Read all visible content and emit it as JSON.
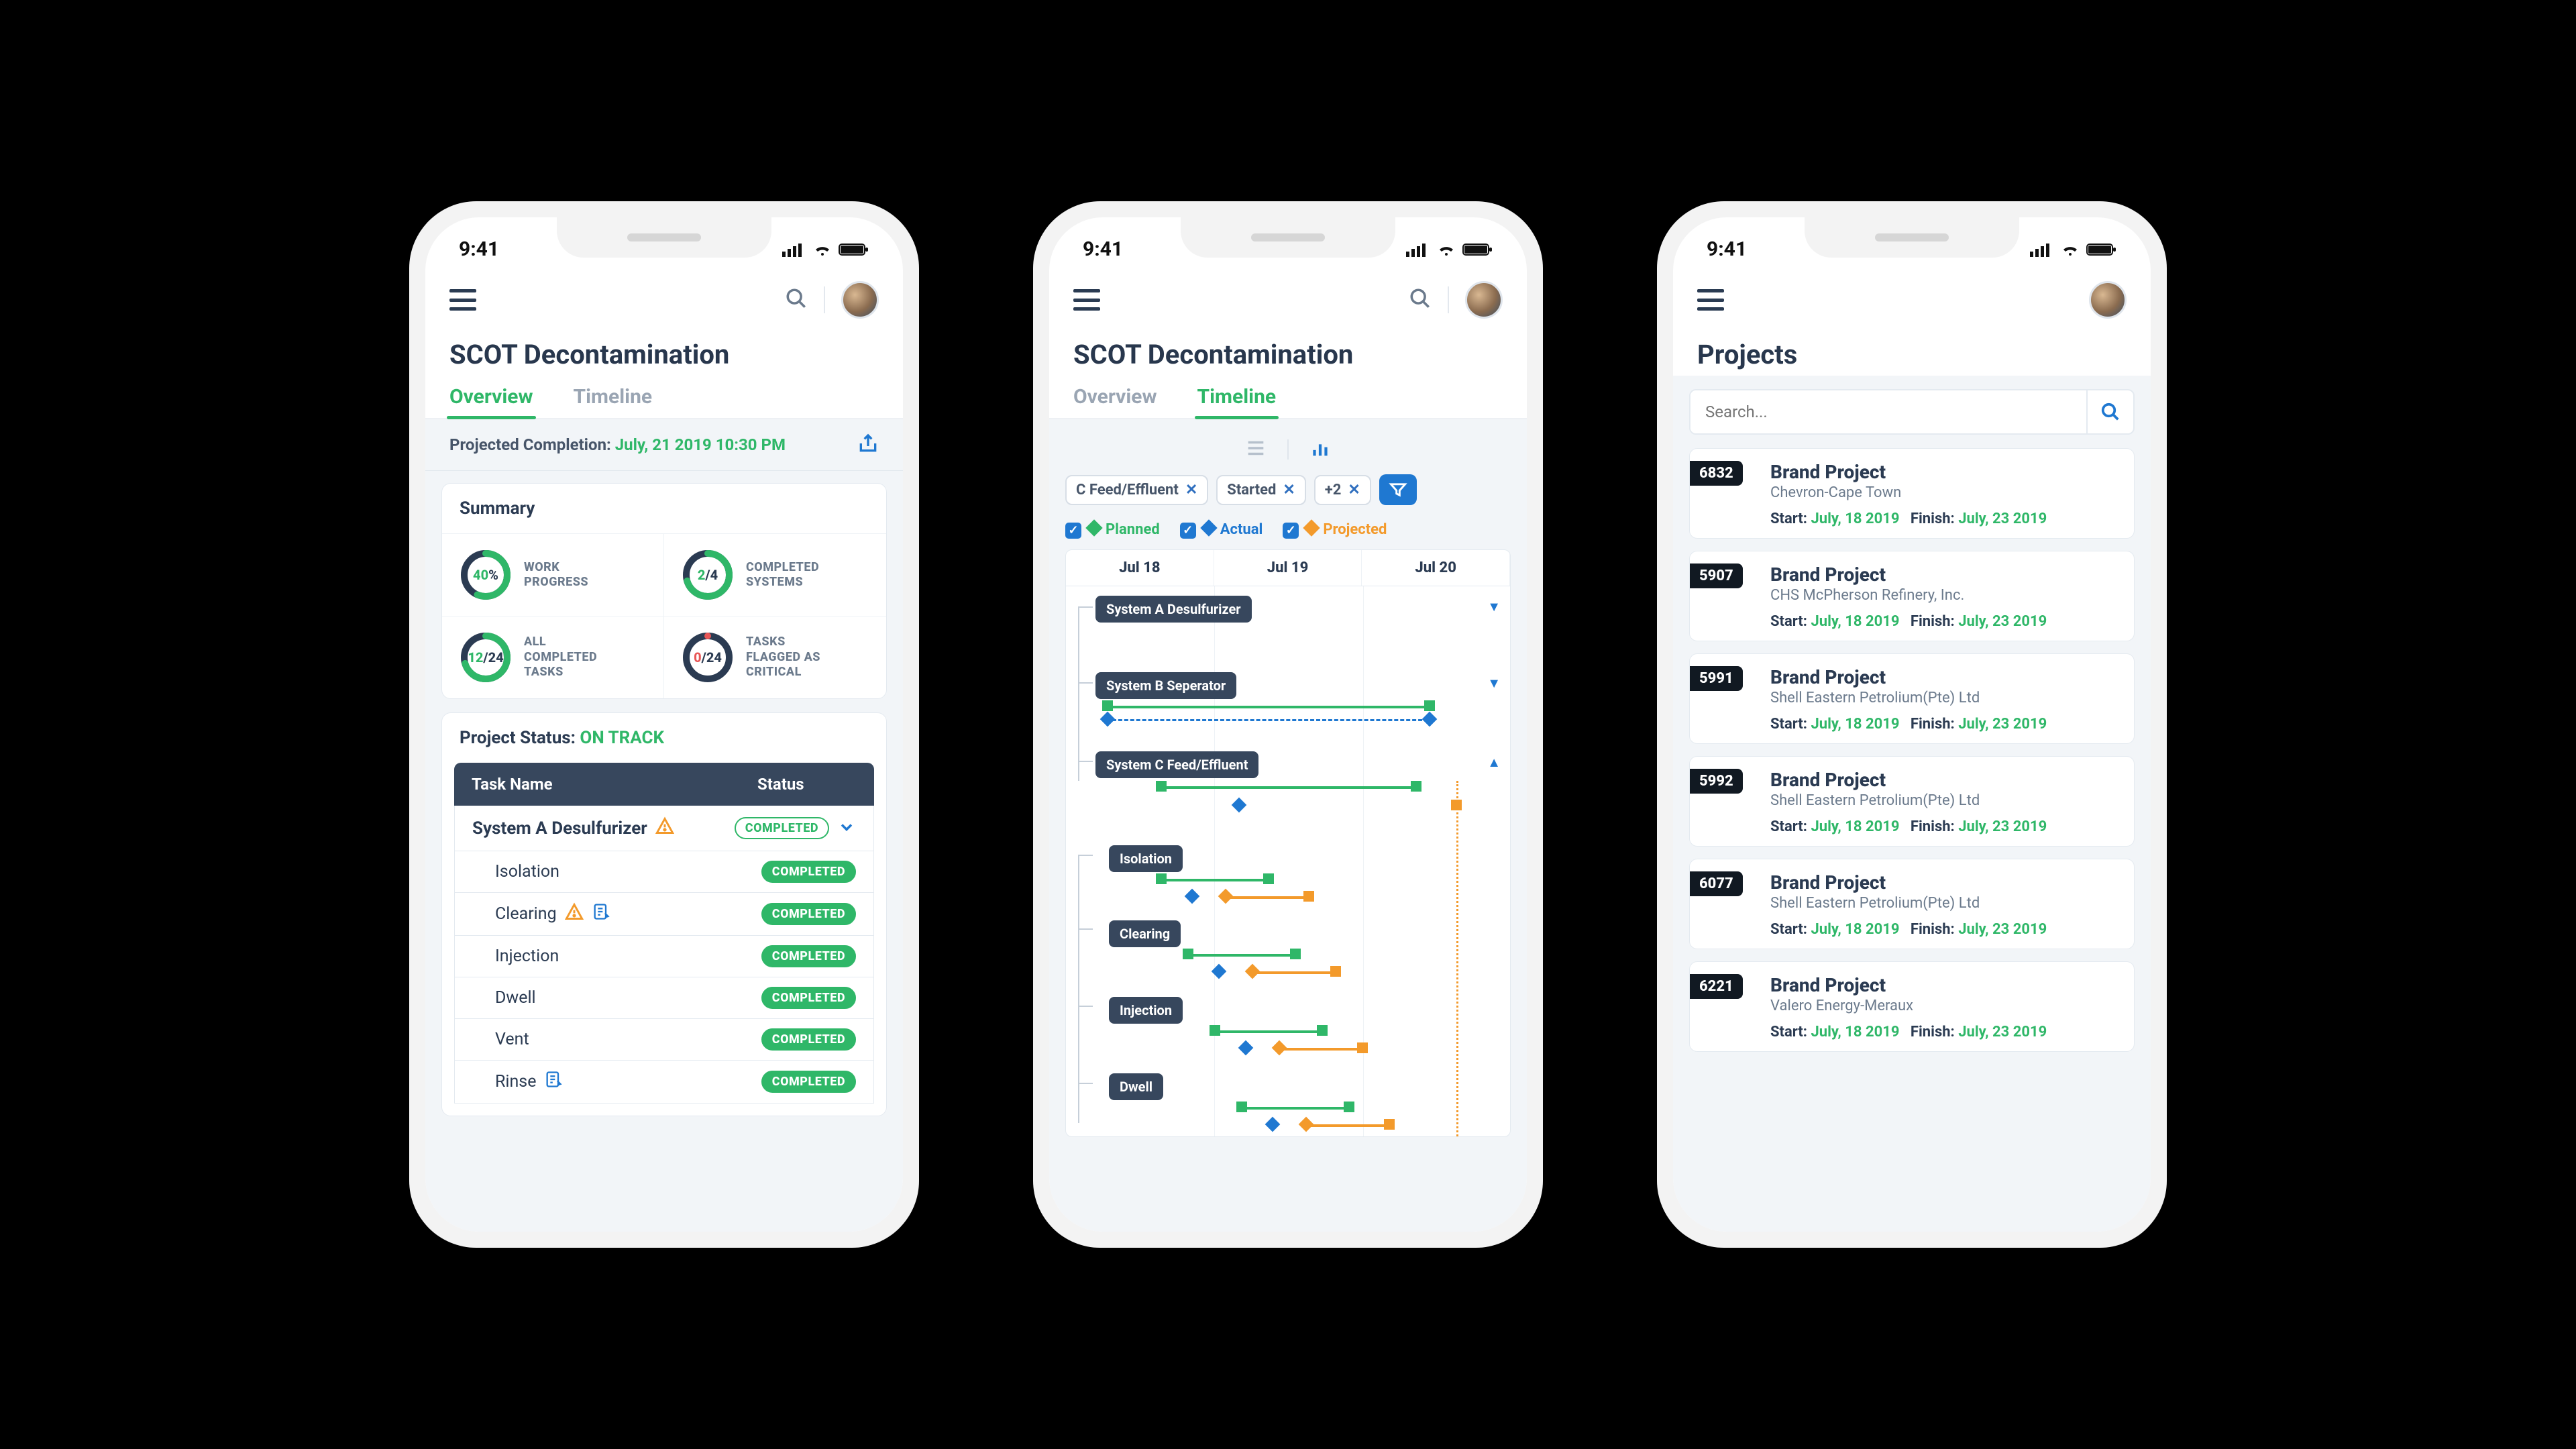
{
  "status_time": "9:41",
  "colors": {
    "accent": "#2fb768",
    "primary_dark": "#37475d",
    "blue": "#1f78d1",
    "orange": "#f39a2b"
  },
  "phone1": {
    "title": "SCOT Decontamination",
    "tabs": {
      "overview": "Overview",
      "timeline": "Timeline",
      "active": "overview"
    },
    "projected_label": "Projected Completion: ",
    "projected_value": "July, 21 2019  10:30 PM",
    "summary_title": "Summary",
    "metrics": [
      {
        "value_html": "<span class='g'>40</span> %",
        "label": "WORK<br>PROGRESS",
        "pct": 40,
        "ring": "green"
      },
      {
        "value_html": "<span class='g'>2</span>/4",
        "label": "COMPLETED<br>SYSTEMS",
        "pct": 50,
        "ring": "green"
      },
      {
        "value_html": "<span class='g'>12</span>/24",
        "label": "ALL<br>COMPLETED<br>TASKS",
        "pct": 50,
        "ring": "green"
      },
      {
        "value_html": "<span class='r'>0</span>/24",
        "label": "TASKS<br>FLAGGED AS<br>CRITICAL",
        "pct": 0,
        "ring": "red"
      }
    ],
    "status_label": "Project Status: ",
    "status_value": "ON TRACK",
    "table": {
      "col_name": "Task Name",
      "col_status": "Status",
      "system": {
        "name": "System A Desulfurizer",
        "badge": "COMPLETED",
        "warn": true
      },
      "tasks": [
        {
          "name": "Isolation",
          "badge": "COMPLETED"
        },
        {
          "name": "Clearing",
          "badge": "COMPLETED",
          "warn": true,
          "note": true
        },
        {
          "name": "Injection",
          "badge": "COMPLETED"
        },
        {
          "name": "Dwell",
          "badge": "COMPLETED"
        },
        {
          "name": "Vent",
          "badge": "COMPLETED"
        },
        {
          "name": "Rinse",
          "badge": "COMPLETED",
          "note": true
        }
      ]
    }
  },
  "phone2": {
    "title": "SCOT Decontamination",
    "tabs": {
      "overview": "Overview",
      "timeline": "Timeline",
      "active": "timeline"
    },
    "filters": [
      {
        "label": "C Feed/Effluent"
      },
      {
        "label": "Started"
      },
      {
        "label": "+2"
      }
    ],
    "legend": {
      "planned": "Planned",
      "actual": "Actual",
      "projected": "Projected"
    },
    "dates": [
      "Jul 18",
      "Jul 19",
      "Jul 20"
    ],
    "systems": [
      {
        "name": "System A Desulfurizer",
        "collapsed": true
      },
      {
        "name": "System B Seperator",
        "collapsed": true
      },
      {
        "name": "System C Feed/Effluent",
        "collapsed": false
      }
    ],
    "tasks": [
      "Isolation",
      "Clearing",
      "Injection",
      "Dwell"
    ]
  },
  "phone3": {
    "title": "Projects",
    "search_placeholder": "Search...",
    "start_label": "Start: ",
    "finish_label": "Finish: ",
    "projects": [
      {
        "id": "6832",
        "name": "Brand Project",
        "client": "Chevron-Cape Town",
        "start": "July, 18 2019",
        "finish": "July, 23 2019"
      },
      {
        "id": "5907",
        "name": "Brand Project",
        "client": "CHS McPherson Refinery, Inc.",
        "start": "July, 18 2019",
        "finish": "July, 23 2019"
      },
      {
        "id": "5991",
        "name": "Brand Project",
        "client": "Shell Eastern Petrolium(Pte) Ltd",
        "start": "July, 18 2019",
        "finish": "July, 23 2019"
      },
      {
        "id": "5992",
        "name": "Brand Project",
        "client": "Shell Eastern Petrolium(Pte) Ltd",
        "start": "July, 18 2019",
        "finish": "July, 23 2019"
      },
      {
        "id": "6077",
        "name": "Brand Project",
        "client": "Shell Eastern Petrolium(Pte) Ltd",
        "start": "July, 18 2019",
        "finish": "July, 23 2019"
      },
      {
        "id": "6221",
        "name": "Brand Project",
        "client": "Valero Energy-Meraux",
        "start": "July, 18 2019",
        "finish": "July, 23 2019"
      }
    ]
  }
}
